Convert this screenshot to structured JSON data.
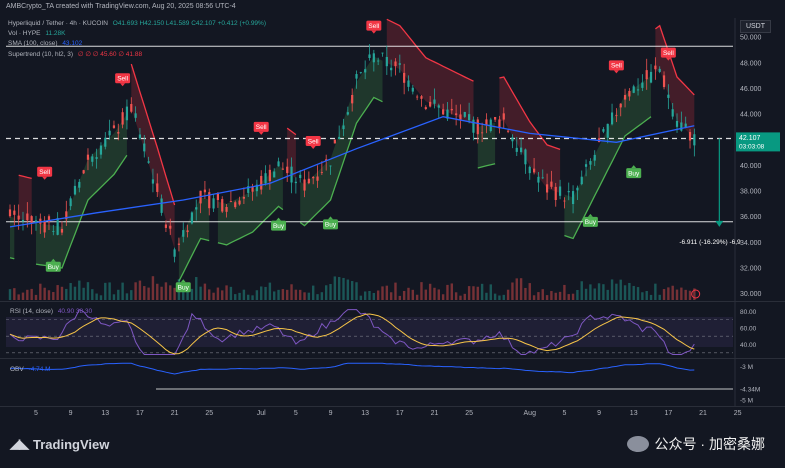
{
  "header": {
    "byline": "AMBCrypto_TA created with TradingView.com, Aug 20, 2025 08:56 UTC-4"
  },
  "legend": {
    "symbol_line": "Hyperliquid / Tether · 4h · KUCOIN",
    "ohlc": "O41.693 H42.150 L41.589 C42.107 +0.412 (+0.99%)",
    "vol_label": "Vol · HYPE",
    "vol_value": "11.28K",
    "sma_label": "SMA (100, close)",
    "sma_value": "43.102",
    "st_label": "Supertrend (10, hl2, 3)",
    "st_values": "∅ ∅ ∅ 45.60 ∅ 41.88"
  },
  "currency": "USDT",
  "price_axis": {
    "labels": [
      "50.000",
      "48.000",
      "46.000",
      "44.000",
      "42.000",
      "40.000",
      "38.000",
      "36.000",
      "34.000",
      "32.000",
      "30.000"
    ],
    "current_price": "42.107",
    "countdown": "03:03:08"
  },
  "measure_label": "-6.911 (-16.29%) -6,9",
  "rsi": {
    "label": "RSI (14, close)",
    "values_text": "40.90 38.30",
    "axis": [
      "80.00",
      "60.00",
      "40.00"
    ]
  },
  "obv": {
    "label": "OBV",
    "value_text": "-4.74 M",
    "axis": [
      "-3 M",
      "-4.34M",
      "-5 M"
    ]
  },
  "time_axis": [
    "5",
    "9",
    "13",
    "17",
    "21",
    "25",
    "Jul",
    "5",
    "9",
    "13",
    "17",
    "21",
    "25",
    "Aug",
    "5",
    "9",
    "13",
    "17",
    "21",
    "25"
  ],
  "signals": [
    {
      "label": "Sell",
      "x": "Jun 6",
      "y": 38.8
    },
    {
      "label": "Buy",
      "x": "Jun 7",
      "y": 32.8
    },
    {
      "label": "Sell",
      "x": "Jun 15",
      "y": 46.1
    },
    {
      "label": "Buy",
      "x": "Jun 22",
      "y": 31.2
    },
    {
      "label": "Sell",
      "x": "Jul 1",
      "y": 42.3
    },
    {
      "label": "Buy",
      "x": "Jul 3",
      "y": 36.0
    },
    {
      "label": "Sell",
      "x": "Jul 7",
      "y": 41.2
    },
    {
      "label": "Buy",
      "x": "Jul 9",
      "y": 36.1
    },
    {
      "label": "Sell",
      "x": "Jul 14",
      "y": 50.2
    },
    {
      "label": "Buy",
      "x": "Aug 8",
      "y": 36.3
    },
    {
      "label": "Sell",
      "x": "Aug 11",
      "y": 47.1
    },
    {
      "label": "Buy",
      "x": "Aug 13",
      "y": 40.1
    },
    {
      "label": "Sell",
      "x": "Aug 17",
      "y": 48.1
    }
  ],
  "chart_data": {
    "type": "line",
    "title": "Hyperliquid / Tether · 4h · KUCOIN",
    "ylim": [
      29.5,
      51.5
    ],
    "x_range": [
      "Jun 2",
      "Aug 24"
    ],
    "series": [
      {
        "name": "close (approx.)",
        "x": [
          "Jun 2",
          "Jun 5",
          "Jun 8",
          "Jun 11",
          "Jun 14",
          "Jun 16",
          "Jun 19",
          "Jun 21",
          "Jun 24",
          "Jun 27",
          "Jun 30",
          "Jul 3",
          "Jul 6",
          "Jul 9",
          "Jul 12",
          "Jul 14",
          "Jul 17",
          "Jul 20",
          "Jul 23",
          "Jul 26",
          "Jul 29",
          "Aug 1",
          "Aug 3",
          "Aug 6",
          "Aug 9",
          "Aug 12",
          "Aug 14",
          "Aug 16",
          "Aug 18",
          "Aug 20"
        ],
        "values": [
          36.0,
          35.5,
          35.2,
          40.5,
          42.5,
          44.5,
          38.0,
          33.5,
          37.5,
          37.0,
          38.0,
          40.0,
          38.5,
          40.5,
          46.5,
          48.5,
          47.5,
          45.0,
          44.0,
          43.0,
          43.5,
          40.0,
          38.2,
          37.5,
          41.5,
          45.5,
          46.5,
          47.5,
          43.5,
          42.1
        ]
      },
      {
        "name": "SMA (100, close)",
        "x": [
          "Jun 2",
          "Jun 12",
          "Jun 22",
          "Jul 2",
          "Jul 12",
          "Jul 22",
          "Aug 1",
          "Aug 11",
          "Aug 20"
        ],
        "values": [
          35.2,
          36.3,
          37.3,
          38.6,
          41.3,
          43.8,
          42.5,
          41.8,
          43.1
        ]
      }
    ],
    "horizontal_lines": [
      49.3,
      42.1,
      35.6
    ],
    "measure": {
      "from": 42.107,
      "to": 35.2,
      "label": "-6.911 (-16.29%)"
    },
    "colors": {
      "up": "#26a69a",
      "down": "#ef5350",
      "sma": "#2962ff",
      "supertrend_up": "#4caf50",
      "supertrend_down": "#f23645",
      "rsi": "#7e57c2",
      "rsi_ma": "#f7c548",
      "obv": "#2962ff"
    }
  }
}
